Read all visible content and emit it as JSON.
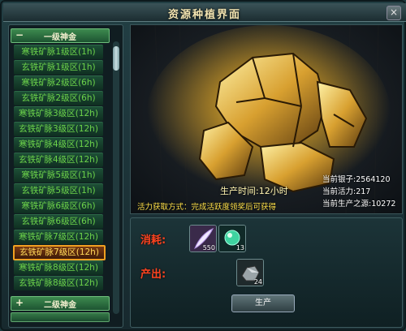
{
  "window": {
    "title": "资源种植界面",
    "close_icon": "close-icon"
  },
  "sidebar": {
    "categories": [
      {
        "sign": "−",
        "label": "一级神金",
        "expanded": true
      },
      {
        "sign": "+",
        "label": "二级神金",
        "expanded": false
      }
    ],
    "items": [
      {
        "label": "寒铁矿脉1级区(1h)"
      },
      {
        "label": "玄铁矿脉1级区(1h)"
      },
      {
        "label": "寒铁矿脉2级区(6h)"
      },
      {
        "label": "玄铁矿脉2级区(6h)"
      },
      {
        "label": "寒铁矿脉3级区(12h)"
      },
      {
        "label": "玄铁矿脉3级区(12h)"
      },
      {
        "label": "寒铁矿脉4级区(12h)"
      },
      {
        "label": "玄铁矿脉4级区(12h)"
      },
      {
        "label": "寒铁矿脉5级区(1h)"
      },
      {
        "label": "玄铁矿脉5级区(1h)"
      },
      {
        "label": "寒铁矿脉6级区(6h)"
      },
      {
        "label": "玄铁矿脉6级区(6h)"
      },
      {
        "label": "寒铁矿脉7级区(12h)"
      },
      {
        "label": "玄铁矿脉7级区(12h)",
        "selected": true
      },
      {
        "label": "寒铁矿脉8级区(12h)"
      },
      {
        "label": "玄铁矿脉8级区(12h)"
      }
    ]
  },
  "preview": {
    "production_time": "生产时间:12小时",
    "vitality_tip": "活力获取方式：完成活跃度领奖后可获得",
    "stats": {
      "silver": "当前银子:2564120",
      "vitality": "当前活力:217",
      "production_source": "当前生产之源:10272"
    },
    "ore_icon": "gold-ore-icon"
  },
  "bottom": {
    "consume_label": "消耗:",
    "output_label": "产出:",
    "consume_items": [
      {
        "icon": "feather-quill-icon",
        "count": "550"
      },
      {
        "icon": "green-orb-icon",
        "count": "13"
      }
    ],
    "output_items": [
      {
        "icon": "iron-ore-icon",
        "count": "24"
      }
    ],
    "produce_button": "生产"
  }
}
